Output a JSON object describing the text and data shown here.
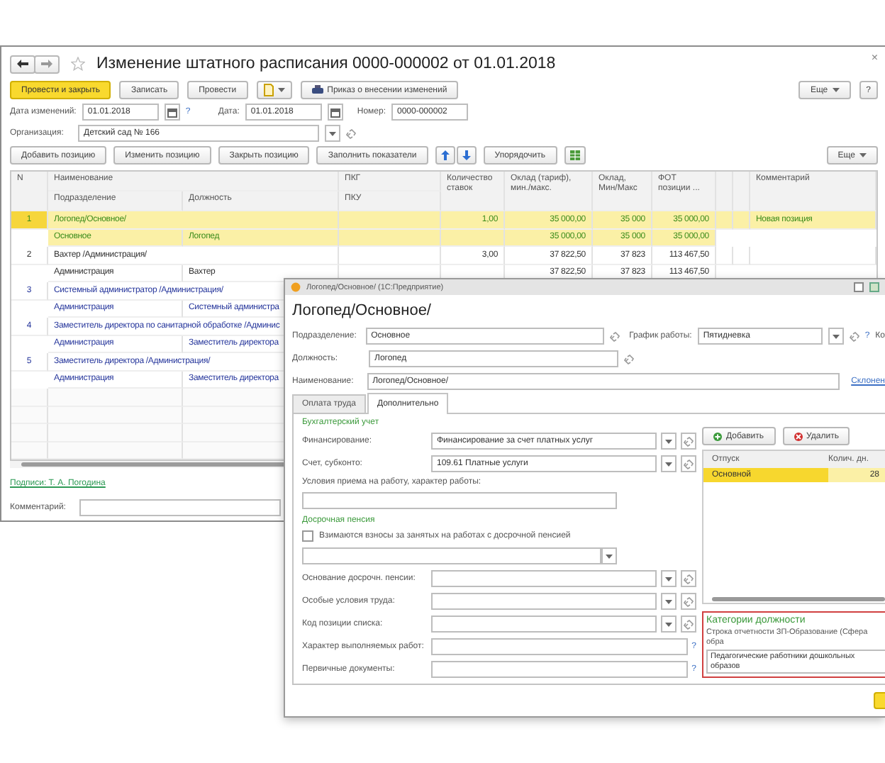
{
  "main_window": {
    "title": "Изменение штатного расписания 0000-000002 от 01.01.2018",
    "close_button": "×",
    "toolbar": [
      {
        "label": "Провести и закрыть",
        "kind": "primary"
      },
      {
        "label": "Записать",
        "kind": "button"
      },
      {
        "label": "Провести",
        "kind": "button"
      },
      {
        "kind": "menu"
      },
      {
        "label": "Приказ о внесении изменений",
        "kind": "print"
      }
    ],
    "more_button": "Еще",
    "help_button": "?",
    "date_label": "Дата изменений:",
    "date_value": "01.01.2018",
    "date_help": "?",
    "doc_date_label": "Дата:",
    "doc_date_value": "01.01.2018",
    "number_label": "Номер:",
    "number_value": "0000-000002",
    "org_label": "Организация:",
    "org_value": "Детский сад № 166",
    "table_toolbar": [
      "Добавить позицию",
      "Изменить позицию",
      "Закрыть позицию",
      "Заполнить показатели"
    ],
    "order_button": "Упорядочить",
    "table_more_button": "Еще",
    "table": {
      "columns": [
        {
          "top": "N"
        },
        {
          "top": "Наименование",
          "sub": [
            "Подразделение",
            "Должность"
          ]
        },
        {
          "top": "ПКГ",
          "sub": [
            "ПКУ"
          ]
        },
        {
          "top": "Количество ставок"
        },
        {
          "top": "Оклад (тариф), мин./макс."
        },
        {
          "top": "Оклад, Мин/Макс"
        },
        {
          "top": "ФОТ позиции ..."
        },
        {
          "top": "Комментарий"
        }
      ],
      "rows": [
        {
          "number": "1",
          "name": "Логопед/Основное/",
          "department": "Основное",
          "position": "Логопед",
          "rate": "1,00",
          "salary": [
            "35 000,00",
            "35 000,00"
          ],
          "salary_round": [
            "35 000",
            "35 000"
          ],
          "payroll": [
            "35 000,00",
            "35 000,00"
          ],
          "comment": "Новая позиция",
          "kind": "new",
          "selected": true
        },
        {
          "number": "2",
          "name": "Вахтер /Администрация/",
          "department": "Администрация",
          "position": "Вахтер",
          "rate": "3,00",
          "salary": [
            "37 822,50",
            "37 822,50"
          ],
          "salary_round": [
            "37 823",
            "37 823"
          ],
          "payroll": [
            "113 467,50",
            "113 467,50"
          ],
          "kind": "current",
          "selected": false
        },
        {
          "number": "3",
          "name": "Системный администратор /Администрация/",
          "department": "Администрация",
          "position": "Системный администра",
          "kind": "other",
          "selected": false
        },
        {
          "number": "4",
          "name": "Заместитель директора по санитарной обработке /Админис",
          "department": "Администрация",
          "position": "Заместитель директора",
          "kind": "other",
          "selected": false
        },
        {
          "number": "5",
          "name": "Заместитель директора /Администрация/",
          "department": "Администрация",
          "position": "Заместитель директора",
          "kind": "other",
          "selected": false
        }
      ]
    },
    "signatures_link": "Подписи: Т. А. Погодина",
    "comment_label": "Комментарий:"
  },
  "dialog": {
    "title": "Логопед/Основное/ (1С:Предприятие)",
    "heading": "Логопед/Основное/",
    "department_label": "Подразделение:",
    "department_value": "Основное",
    "schedule_label": "График работы:",
    "schedule_value": "Пятидневка",
    "schedule_help": "?",
    "cut_label": "Ко",
    "position_label": "Должность:",
    "position_value": "Логопед",
    "name_label": "Наименование:",
    "name_value": "Логопед/Основное/",
    "declension_link": "Склонен",
    "tabs": [
      {
        "label": "Оплата труда",
        "selected": false
      },
      {
        "label": "Дополнительно",
        "selected": true
      }
    ],
    "accounting_title": "Бухгалтерский учет",
    "accounting_fields": [
      {
        "label": "Финансирование:",
        "value": "Финансирование за счет платных услуг"
      },
      {
        "label": "Счет, субконто:",
        "value": "109.61 Платные услуги"
      }
    ],
    "conditions_label": "Условия приема на работу, характер работы:",
    "pension_title": "Досрочная пенсия",
    "pension_checkbox": {
      "label": "Взимаются взносы за занятых на работах с досрочной пенсией",
      "checked": false
    },
    "fields": [
      {
        "label": "Основание досрочн. пенсии:",
        "kind": "select"
      },
      {
        "label": "Особые условия труда:",
        "kind": "select"
      },
      {
        "label": "Код позиции списка:",
        "kind": "select"
      },
      {
        "label": "Характер выполняемых работ:",
        "kind": "text",
        "help": "?"
      },
      {
        "label": "Первичные документы:",
        "kind": "text",
        "help": "?"
      }
    ],
    "add_button": "Добавить",
    "delete_button": "Удалить",
    "vacation_columns": [
      "Отпуск",
      "Колич. дн."
    ],
    "vacation_rows": [
      {
        "type": "Основной",
        "days": "28",
        "selected": true
      }
    ],
    "categories_title": "Категории должности",
    "report_label": "Строка отчетности ЗП-Образование (Сфера обра",
    "category_value": "Педагогические работники дошкольных образов"
  }
}
